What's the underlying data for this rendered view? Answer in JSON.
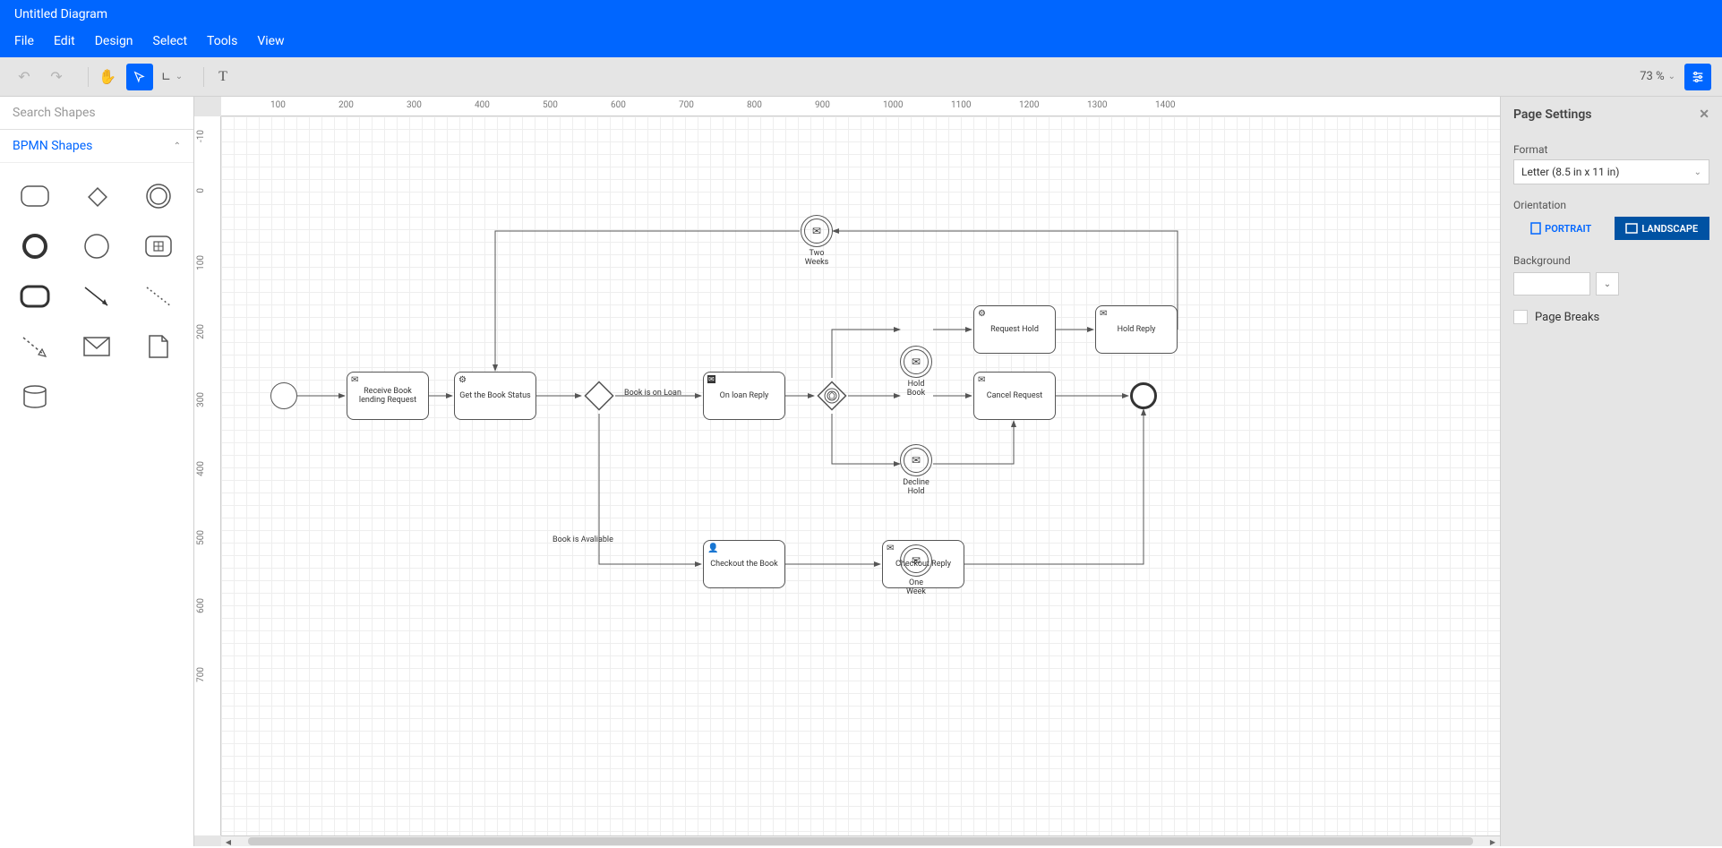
{
  "title": "Untitled Diagram",
  "menu": {
    "file": "File",
    "edit": "Edit",
    "design": "Design",
    "select": "Select",
    "tools": "Tools",
    "view": "View"
  },
  "zoom": "73 %",
  "sidebar": {
    "search_placeholder": "Search Shapes",
    "section": "BPMN Shapes"
  },
  "ruler_h": [
    "100",
    "200",
    "300",
    "400",
    "500",
    "600",
    "700",
    "800",
    "900",
    "1000",
    "1100",
    "1200",
    "1300",
    "1400"
  ],
  "ruler_v": [
    "-10",
    "0",
    "100",
    "200",
    "300",
    "400",
    "500",
    "600",
    "700"
  ],
  "nodes": {
    "receive": "Receive Book lending Request",
    "get_status": "Get the Book Status",
    "on_loan_reply": "On loan Reply",
    "request_hold": "Request Hold",
    "hold_reply": "Hold Reply",
    "cancel_request": "Cancel Request",
    "checkout_book": "Checkout the Book",
    "checkout_reply": "Checkout Reply"
  },
  "events": {
    "two_weeks": "Two\nWeeks",
    "hold_book": "Hold\nBook",
    "decline_hold": "Decline\nHold",
    "one_week": "One\nWeek"
  },
  "edges": {
    "on_loan": "Book is on Loan",
    "available": "Book is Avaliable"
  },
  "props": {
    "title": "Page Settings",
    "format_label": "Format",
    "format_value": "Letter (8.5 in x 11 in)",
    "orient_label": "Orientation",
    "portrait": "PORTRAIT",
    "landscape": "LANDSCAPE",
    "background_label": "Background",
    "page_breaks": "Page Breaks"
  }
}
